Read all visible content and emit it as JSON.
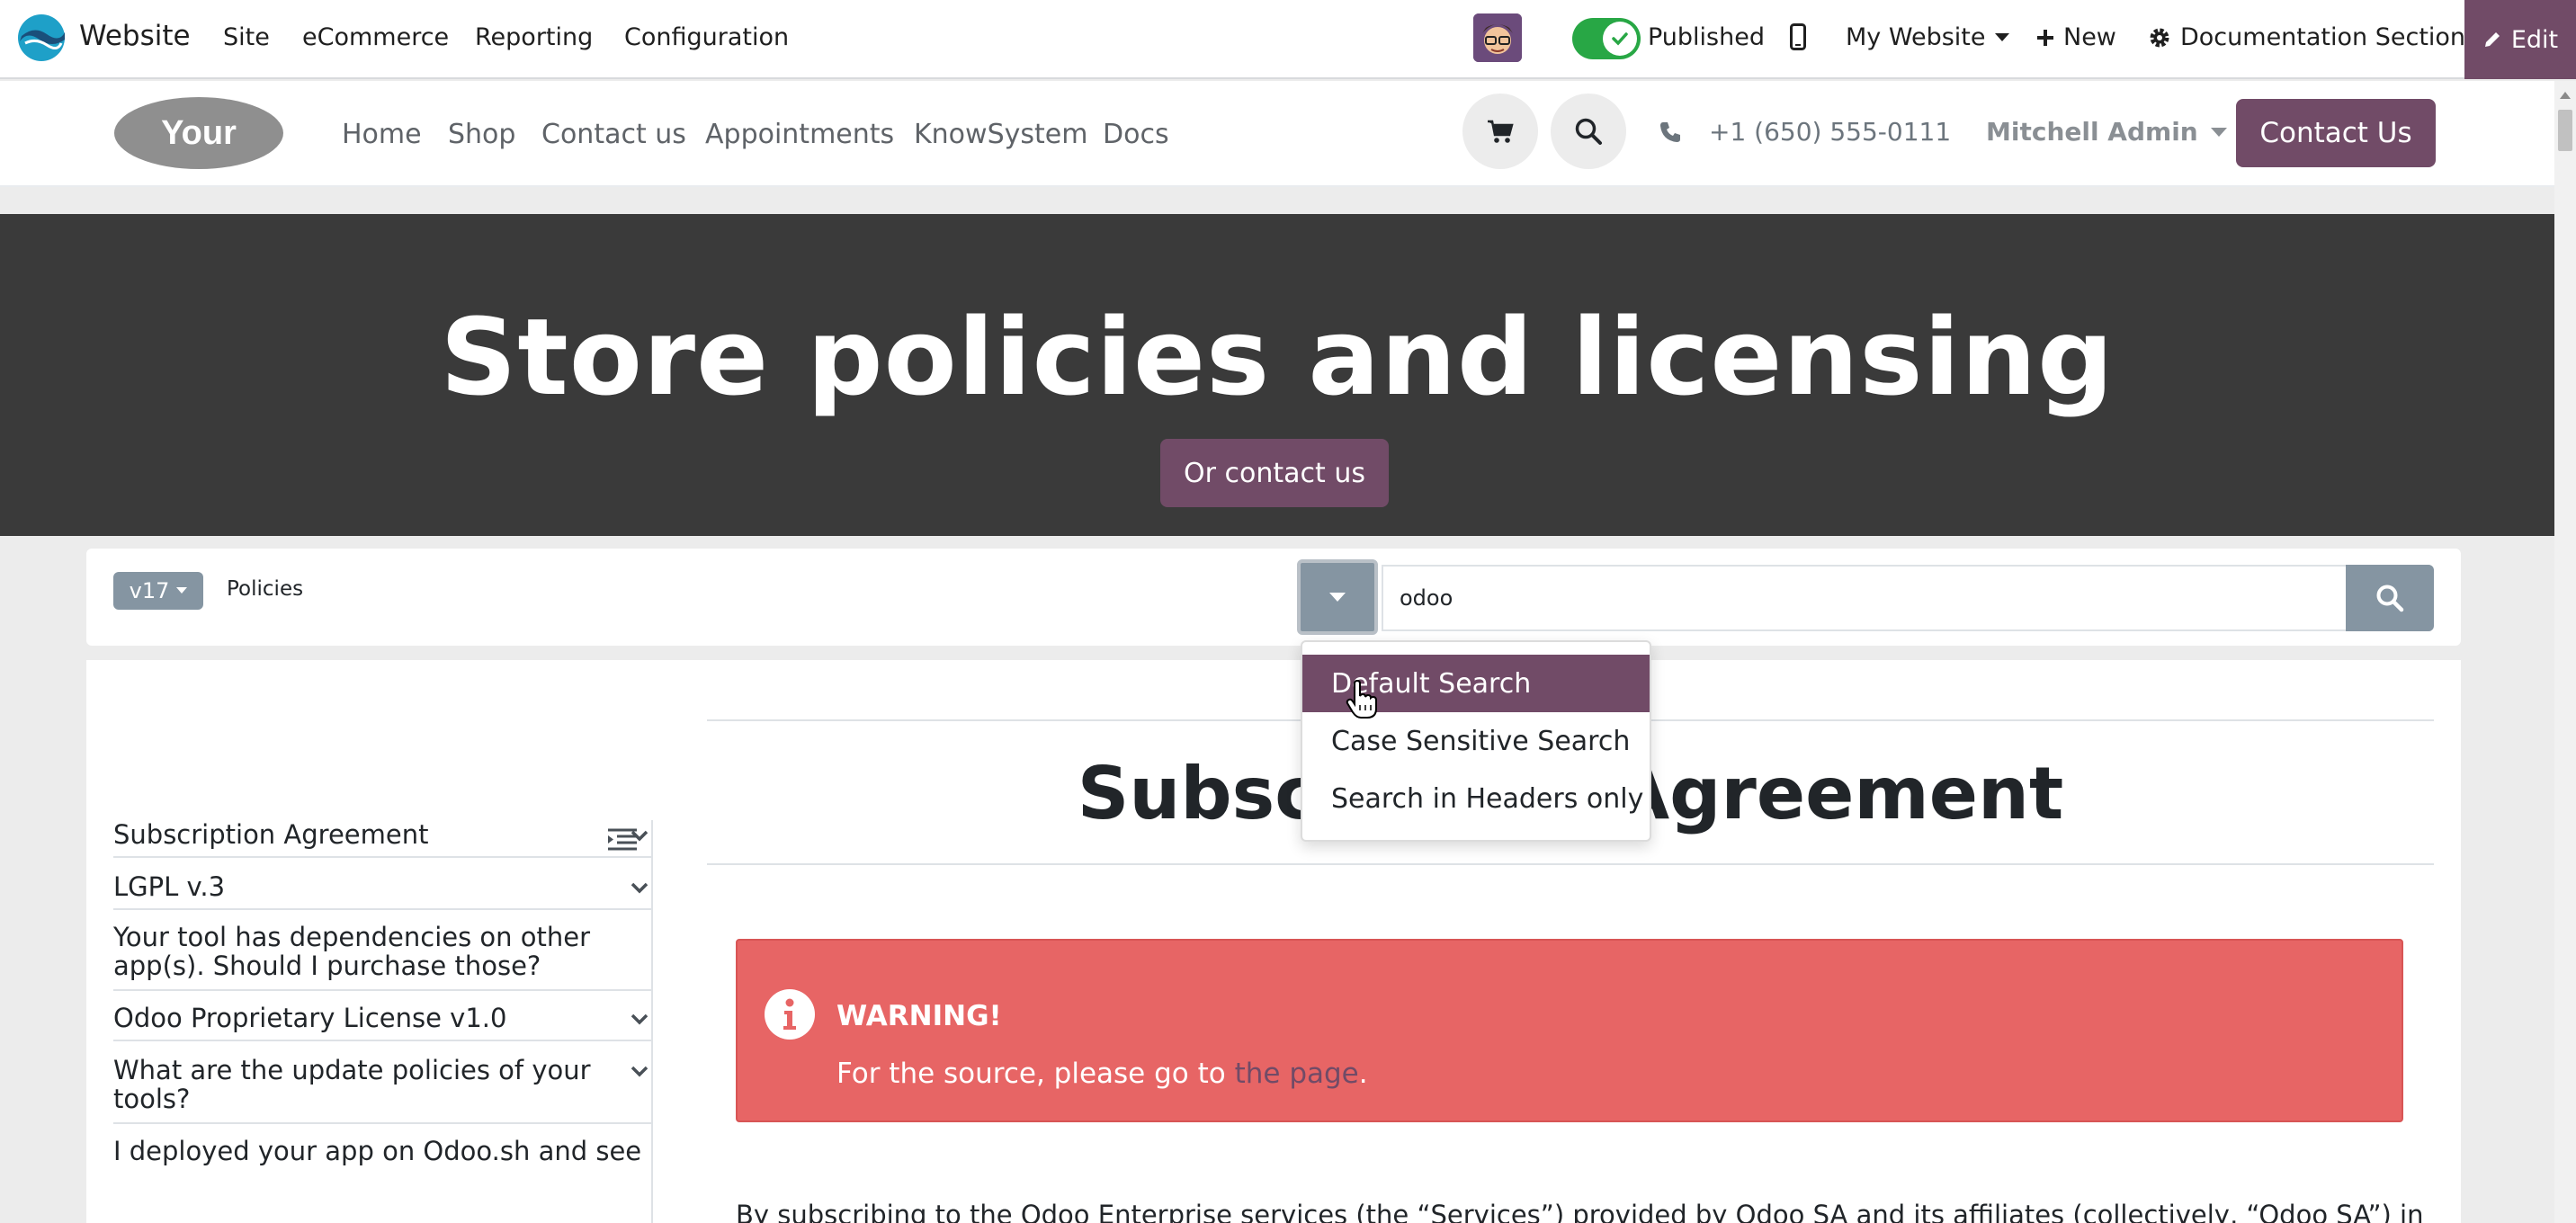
{
  "admin_bar": {
    "app_name": "Website",
    "menus": [
      "Site",
      "eCommerce",
      "Reporting",
      "Configuration"
    ],
    "published_label": "Published",
    "website_selector": "My Website",
    "new_label": "New",
    "section_label": "Documentation Section",
    "edit_label": "Edit"
  },
  "site_header": {
    "nav": [
      "Home",
      "Shop",
      "Contact us",
      "Appointments",
      "KnowSystem",
      "Docs"
    ],
    "phone": "+1 (650) 555-0111",
    "user": "Mitchell Admin",
    "contact_button": "Contact Us"
  },
  "hero": {
    "title": "Store policies and licensing",
    "button": "Or contact us"
  },
  "search_bar": {
    "version": "v17",
    "breadcrumb": "Policies",
    "query": "odoo"
  },
  "search_options": [
    {
      "label": "Default Search",
      "active": true
    },
    {
      "label": "Case Sensitive Search",
      "active": false
    },
    {
      "label": "Search in Headers only",
      "active": false
    }
  ],
  "toc": [
    "Subscription Agreement",
    "LGPL v.3",
    "Your tool has dependencies on other app(s). Should I purchase those?",
    "Odoo Proprietary License v1.0",
    "What are the update policies of your tools?",
    "I deployed your app on Odoo.sh and see"
  ],
  "article": {
    "title": "Subscription Agreement",
    "warning_title": "WARNING!",
    "warning_text": "For the source, please go to ",
    "warning_link": "the page",
    "warning_end": ".",
    "intro": "By subscribing to the Odoo Enterprise services (the “Services”) provided by Odoo SA and its affiliates (collectively, “Odoo SA”) in"
  },
  "colors": {
    "brand": "#714b67",
    "success": "#28a745",
    "warning_bg": "#e76565",
    "hero_bg": "#3a3a3a",
    "secondary": "#8595a2"
  }
}
